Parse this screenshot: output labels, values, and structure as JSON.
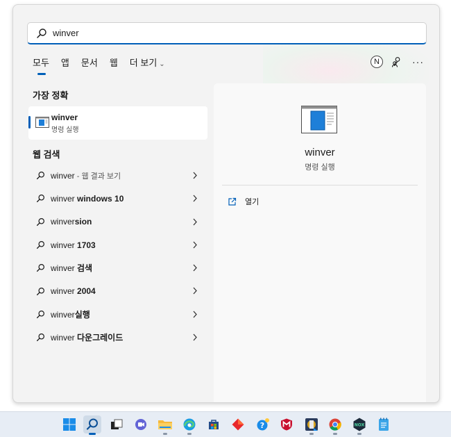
{
  "search": {
    "value": "winver"
  },
  "tabs": [
    {
      "label": "모두",
      "active": true
    },
    {
      "label": "앱"
    },
    {
      "label": "문서"
    },
    {
      "label": "웹"
    },
    {
      "label": "더 보기"
    }
  ],
  "account": {
    "initial": "N"
  },
  "best_match": {
    "title": "가장 정확",
    "name": "winver",
    "subtitle": "명령 실행"
  },
  "web_search": {
    "title": "웹 검색",
    "items": [
      {
        "prefix": "winver",
        "bold": "",
        "muted": " - 웹 결과 보기"
      },
      {
        "prefix": "winver ",
        "bold": "windows 10",
        "muted": ""
      },
      {
        "prefix": "winver",
        "bold": "sion",
        "muted": ""
      },
      {
        "prefix": "winver ",
        "bold": "1703",
        "muted": ""
      },
      {
        "prefix": "winver ",
        "bold": "검색",
        "muted": ""
      },
      {
        "prefix": "winver ",
        "bold": "2004",
        "muted": ""
      },
      {
        "prefix": "winver",
        "bold": "실행",
        "muted": ""
      },
      {
        "prefix": "winver ",
        "bold": "다운그레이드",
        "muted": ""
      }
    ]
  },
  "detail": {
    "name": "winver",
    "subtitle": "명령 실행",
    "actions": [
      {
        "label": "열기",
        "icon": "open-external-icon"
      }
    ]
  },
  "taskbar": {
    "items": [
      {
        "icon": "windows-start-icon"
      },
      {
        "icon": "search-icon",
        "active": true
      },
      {
        "icon": "task-view-icon"
      },
      {
        "icon": "chat-icon"
      },
      {
        "icon": "file-explorer-icon"
      },
      {
        "icon": "edge-icon"
      },
      {
        "icon": "store-icon"
      },
      {
        "icon": "red-diamond-app-icon"
      },
      {
        "icon": "help-app-icon"
      },
      {
        "icon": "mcafee-icon"
      },
      {
        "icon": "media-app-icon"
      },
      {
        "icon": "chrome-icon"
      },
      {
        "icon": "nox-icon"
      },
      {
        "icon": "notepad-icon"
      }
    ]
  },
  "colors": {
    "accent": "#005fb8",
    "panel": "#f3f3f3",
    "taskbar": "#e7edf5"
  }
}
